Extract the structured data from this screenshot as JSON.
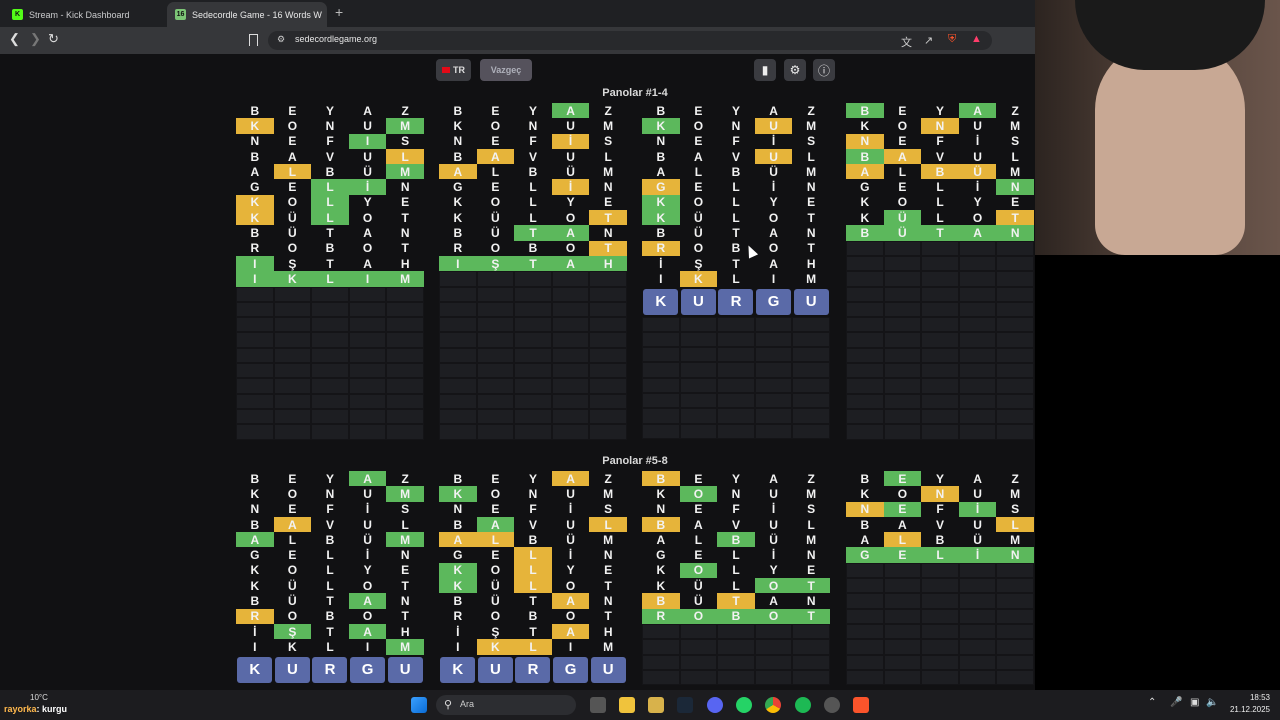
{
  "browser": {
    "tabs": [
      {
        "label": "Stream - Kick Dashboard",
        "favicon": "K",
        "color": "#53fc18"
      },
      {
        "label": "Sedecordle Game - 16 Words W",
        "favicon": "16",
        "color": "#7cc576"
      }
    ],
    "url": "sedecordlegame.org"
  },
  "game": {
    "lang_label": "TR",
    "giveup_label": "Vazgeç",
    "section1_title": "Panolar #1-4",
    "section2_title": "Panolar #5-8",
    "current_guess": [
      "K",
      "U",
      "R",
      "G",
      "U"
    ],
    "colors": {
      "green": "#5cb85c",
      "yellow": "#e6b43a",
      "typed": "#5a6aa8"
    }
  },
  "boards1": [
    {
      "rows": [
        [
          "B",
          ""
        ],
        [
          "E",
          ""
        ],
        [
          "Y",
          ""
        ],
        [
          "A",
          ""
        ],
        [
          "Z",
          ""
        ]
      ],
      "grid": [
        "BEYAZ",
        "KONUM",
        "NEFIS",
        "BAVUL",
        "ALBÜM",
        "GELİN",
        "KOLYE",
        "KÜLOT",
        "BÜTAN",
        "ROBOT",
        "IŞTAH",
        "IKLIM"
      ],
      "marks": [
        "-----",
        "y---g",
        "---g-",
        "----y",
        "-y--g",
        "--gg-",
        "y-g--",
        "y-g--",
        "-----",
        "-----",
        "g----",
        "ggggg"
      ]
    },
    {
      "grid": [
        "BEYAZ",
        "KONUM",
        "NEFİS",
        "BAVUL",
        "ALBÜM",
        "GELİN",
        "KOLYE",
        "KÜLOT",
        "BÜTAN",
        "ROBOT",
        "IŞTAH"
      ],
      "marks": [
        "---g-",
        "-----",
        "---y-",
        "-y---",
        "y----",
        "---y-",
        "-----",
        "----y",
        "--gg-",
        "----y",
        "ggggg"
      ]
    },
    {
      "grid": [
        "BEYAZ",
        "KONUM",
        "NEFİS",
        "BAVUL",
        "ALBÜM",
        "GELİN",
        "KOLYE",
        "KÜLOT",
        "BÜTAN",
        "ROBOT",
        "İŞTAH",
        "IKLIM"
      ],
      "marks": [
        "-----",
        "g--y-",
        "-----",
        "---y-",
        "-----",
        "y----",
        "g----",
        "g----",
        "-----",
        "y----",
        "-----",
        "-y---"
      ]
    },
    {
      "grid": [
        "BEYAZ",
        "KONUM",
        "NEFİS",
        "BAVUL",
        "ALBÜM",
        "GELİN",
        "KOLYE",
        "KÜLOT",
        "BÜTAN"
      ],
      "marks": [
        "g--g-",
        "--y--",
        "y----",
        "gy---",
        "y-yy-",
        "----g",
        "-----",
        "-g--y",
        "ggggg"
      ]
    }
  ],
  "boards2": [
    {
      "grid": [
        "BEYAZ",
        "KONUM",
        "NEFİS",
        "BAVUL",
        "ALBÜM",
        "GELİN",
        "KOLYE",
        "KÜLOT",
        "BÜTAN",
        "ROBOT",
        "İŞTAH",
        "IKLIM"
      ],
      "marks": [
        "---g-",
        "----g",
        "-----",
        "-y---",
        "g---g",
        "-----",
        "-----",
        "-----",
        "---g-",
        "y----",
        "-g-g-",
        "----g"
      ]
    },
    {
      "grid": [
        "BEYAZ",
        "KONUM",
        "NEFİS",
        "BAVUL",
        "ALBÜM",
        "GELİN",
        "KOLYE",
        "KÜLOT",
        "BÜTAN",
        "ROBOT",
        "İŞTAH",
        "IKLIM"
      ],
      "marks": [
        "---y-",
        "g----",
        "-----",
        "-g--y",
        "yy---",
        "--y--",
        "g-y--",
        "g-y--",
        "---y-",
        "-----",
        "---y-",
        "-yy--"
      ]
    },
    {
      "grid": [
        "BEYAZ",
        "KONUM",
        "NEFİS",
        "BAVUL",
        "ALBÜM",
        "GELİN",
        "KOLYE",
        "KÜLOT",
        "BÜTAN",
        "ROBOT"
      ],
      "marks": [
        "y----",
        "-g---",
        "-----",
        "y----",
        "--g--",
        "-----",
        "-g---",
        "---gg",
        "y-y--",
        "ggggg"
      ]
    },
    {
      "grid": [
        "BEYAZ",
        "KONUM",
        "NEFİS",
        "BAVUL",
        "ALBÜM",
        "GELİN"
      ],
      "marks": [
        "-g---",
        "--y--",
        "yg-g-",
        "----y",
        "-y---",
        "ggggg"
      ]
    }
  ],
  "taskbar": {
    "weather": "10°C",
    "search": "Ara",
    "time": "18:53",
    "date": "21.12.2025",
    "chat_user": "rayorka",
    "chat_msg": ": kurgu"
  }
}
